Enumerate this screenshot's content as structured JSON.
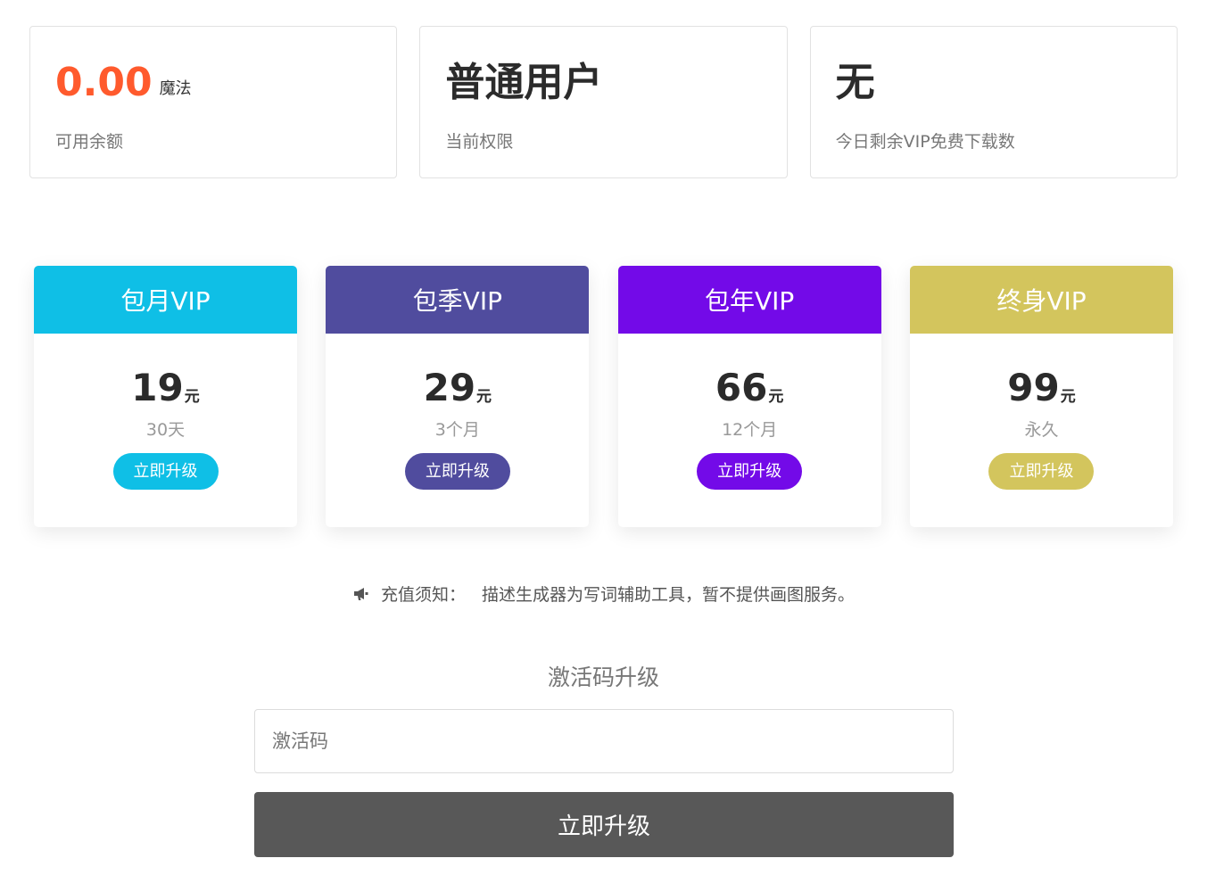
{
  "stats": [
    {
      "value": "0.00",
      "unit": "魔法",
      "label": "可用余额",
      "value_color": "#ff5a2d"
    },
    {
      "value": "普通用户",
      "unit": "",
      "label": "当前权限",
      "value_color": "#2b2b2b"
    },
    {
      "value": "无",
      "unit": "",
      "label": "今日剩余VIP免费下载数",
      "value_color": "#2b2b2b"
    }
  ],
  "plans": [
    {
      "title": "包月VIP",
      "price": "19",
      "currency": "元",
      "duration": "30天",
      "button": "立即升级",
      "color": "#0fbfe6"
    },
    {
      "title": "包季VIP",
      "price": "29",
      "currency": "元",
      "duration": "3个月",
      "button": "立即升级",
      "color": "#504c9e"
    },
    {
      "title": "包年VIP",
      "price": "66",
      "currency": "元",
      "duration": "12个月",
      "button": "立即升级",
      "color": "#730ae8"
    },
    {
      "title": "终身VIP",
      "price": "99",
      "currency": "元",
      "duration": "永久",
      "button": "立即升级",
      "color": "#d3c55d"
    }
  ],
  "notice": {
    "icon": "megaphone-icon",
    "prefix": "充值须知：",
    "text": "描述生成器为写词辅助工具，暂不提供画图服务。"
  },
  "activation": {
    "title": "激活码升级",
    "placeholder": "激活码",
    "value": "",
    "button": "立即升级"
  }
}
